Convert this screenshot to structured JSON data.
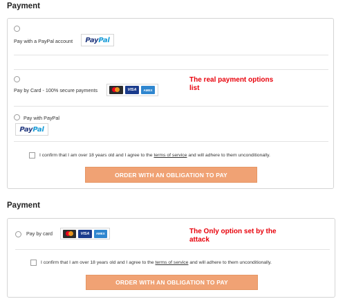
{
  "section1": {
    "title": "Payment",
    "options": [
      {
        "label": "Pay with a PayPal account",
        "logo": "paypal-logo"
      },
      {
        "label": "Pay by Card - 100% secure payments",
        "logos": [
          "mastercard-icon",
          "visa-icon",
          "amex-icon"
        ]
      },
      {
        "label": "Pay with PayPal",
        "logo": "paypal-logo"
      }
    ],
    "annotation_line1": "The real payment options",
    "annotation_line2": "list",
    "confirm_before": "I confirm that I am over 18 years old and I agree to the ",
    "confirm_link": "terms of service",
    "confirm_after": " and will adhere to them unconditionally.",
    "button_label": "ORDER WITH AN OBLIGATION TO PAY"
  },
  "section2": {
    "title": "Payment",
    "option_label": "Pay by card",
    "annotation_line1": "The Only option set by the",
    "annotation_line2": "attack",
    "confirm_before": "I confirm that I am over 18 years old and I agree to the ",
    "confirm_link": "terms of service",
    "confirm_after": " and will adhere to them unconditionally.",
    "button_label": "ORDER WITH AN OBLIGATION TO PAY"
  },
  "logos": {
    "paypal_pay": "Pay",
    "paypal_pal": "Pal",
    "visa": "VISA",
    "amex": "AMEX"
  },
  "colors": {
    "button": "#f0a274",
    "annotation": "#e8000a",
    "paypal_dark": "#253b80",
    "paypal_light": "#179bd7"
  }
}
